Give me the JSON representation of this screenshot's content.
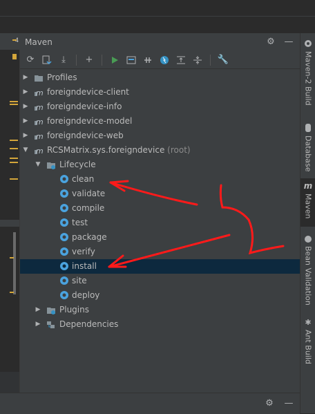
{
  "panel": {
    "title": "Maven",
    "toolbar_icons": [
      "refresh-icon",
      "reimport-icon",
      "download-icon",
      "add-icon",
      "run-icon",
      "execute-goal-icon",
      "toggle-offline-icon",
      "skip-tests-icon",
      "expand-all-icon",
      "collapse-all-icon",
      "settings-wrench-icon"
    ]
  },
  "editor": {
    "fragment_label": "4"
  },
  "tree": {
    "profiles": "Profiles",
    "modules": [
      "foreigndevice-client",
      "foreigndevice-info",
      "foreigndevice-model",
      "foreigndevice-web"
    ],
    "root_name": "RCSMatrix.sys.foreigndevice",
    "root_suffix": "(root)",
    "lifecycle": "Lifecycle",
    "goals": [
      "clean",
      "validate",
      "compile",
      "test",
      "package",
      "verify",
      "install",
      "site",
      "deploy"
    ],
    "selected_goal": "install",
    "plugins": "Plugins",
    "dependencies": "Dependencies"
  },
  "right_strip": {
    "tabs": [
      "Maven-2 Build",
      "Database",
      "Maven",
      "Bean Validation",
      "Ant Build"
    ],
    "active": "Maven"
  },
  "colors": {
    "selection": "#0d293e",
    "accent_gear": "#4aa3df",
    "annotation": "#ff1a1a"
  }
}
